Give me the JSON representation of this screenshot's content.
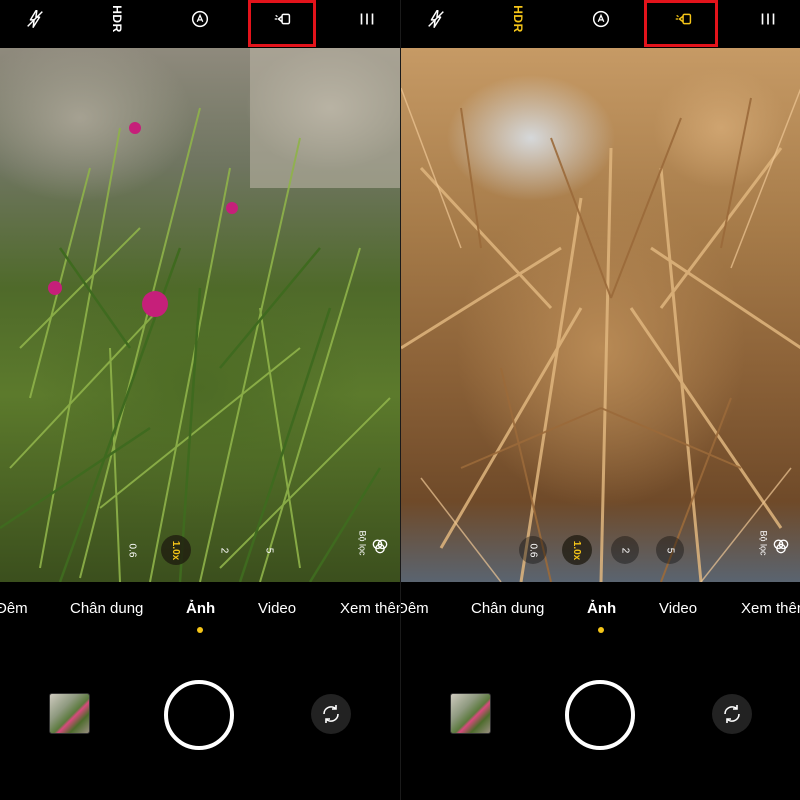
{
  "screens": [
    {
      "id": "left",
      "toolbar": {
        "flash_icon": "flash-off-icon",
        "hdr_label": "HDR",
        "hdr_active": false,
        "ai_icon": "ai-scene-icon",
        "highlighted_icon": "macro-lamp-icon",
        "highlighted_active": false,
        "menu_icon": "menu-icon"
      },
      "zoom": {
        "options": [
          "0.6",
          "1.0x",
          "2",
          "5"
        ],
        "active": "1.0x"
      },
      "filter": {
        "label": "Bộ lọc"
      },
      "modes": [
        "Đêm",
        "Chân dung",
        "Ảnh",
        "Video",
        "Xem thêm"
      ],
      "active_mode": "Ảnh"
    },
    {
      "id": "right",
      "toolbar": {
        "flash_icon": "flash-off-icon",
        "hdr_label": "HDR",
        "hdr_active": true,
        "ai_icon": "ai-scene-icon",
        "highlighted_icon": "macro-lamp-icon",
        "highlighted_active": true,
        "menu_icon": "menu-icon"
      },
      "zoom": {
        "options": [
          "0.6",
          "1.0x",
          "2",
          "5"
        ],
        "active": "1.0x"
      },
      "filter": {
        "label": "Bộ lọc"
      },
      "modes": [
        "Đêm",
        "Chân dung",
        "Ảnh",
        "Video",
        "Xem thêm"
      ],
      "active_mode": "Ảnh"
    }
  ],
  "colors": {
    "accent": "#f5c518",
    "highlight_box": "#e3131b",
    "icon_default": "#ffffff"
  }
}
